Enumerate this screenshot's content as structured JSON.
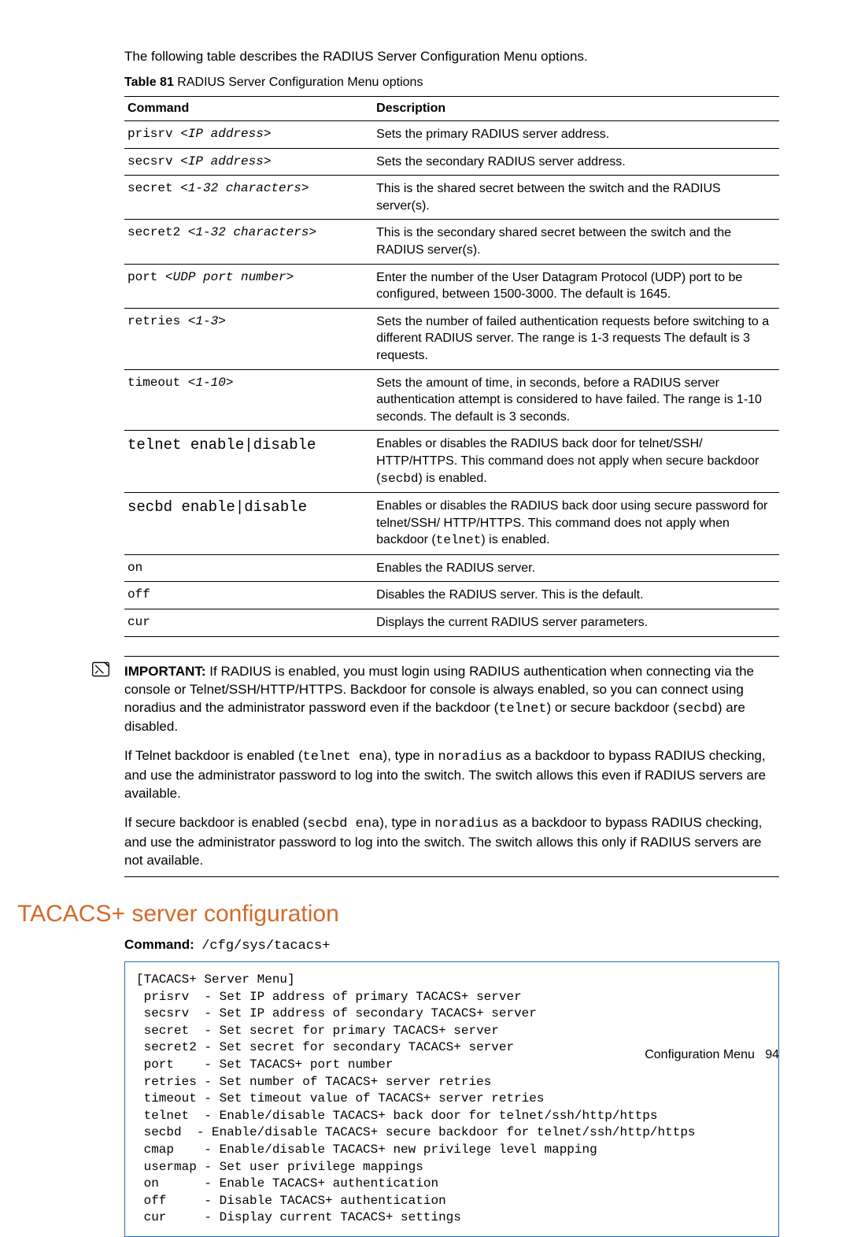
{
  "intro": "The following table describes the RADIUS Server Configuration Menu options.",
  "table_caption_label": "Table 81",
  "table_caption_title": "RADIUS Server Configuration Menu options",
  "table": {
    "headers": {
      "command": "Command",
      "description": "Description"
    },
    "rows": [
      {
        "cmd": "prisrv",
        "arg": "<IP address>",
        "big": false,
        "desc": "Sets the primary RADIUS server address."
      },
      {
        "cmd": "secsrv",
        "arg": "<IP address>",
        "big": false,
        "desc": "Sets the secondary RADIUS server address."
      },
      {
        "cmd": "secret",
        "arg": "<1-32 characters>",
        "big": false,
        "desc": "This is the shared secret between the switch and the RADIUS server(s)."
      },
      {
        "cmd": "secret2",
        "arg": "<1-32 characters>",
        "big": false,
        "desc": "This is the secondary shared secret between the switch and the RADIUS server(s)."
      },
      {
        "cmd": "port",
        "arg": "<UDP port number>",
        "big": false,
        "desc": "Enter the number of the User Datagram Protocol (UDP) port to be configured, between 1500-3000. The default is 1645."
      },
      {
        "cmd": "retries",
        "arg": "<1-3>",
        "big": false,
        "desc": "Sets the number of failed authentication requests before switching to a different RADIUS server. The range is 1-3 requests The default is 3 requests."
      },
      {
        "cmd": "timeout",
        "arg": "<1-10>",
        "big": false,
        "desc": "Sets the amount of time, in seconds, before a RADIUS server authentication attempt is considered to have failed. The range is 1-10 seconds. The default is 3 seconds."
      },
      {
        "cmd": "telnet enable|disable",
        "arg": "",
        "big": true,
        "desc_html": "Enables or disables the RADIUS back door for telnet/SSH/ HTTP/HTTPS. This command does not apply when secure backdoor (<code class=\"inline\">secbd</code>) is enabled."
      },
      {
        "cmd": "secbd enable|disable",
        "arg": "",
        "big": true,
        "desc_html": "Enables or disables the RADIUS back door using secure password for telnet/SSH/ HTTP/HTTPS. This command does not apply when backdoor (<code class=\"inline\">telnet</code>) is enabled."
      },
      {
        "cmd": "on",
        "arg": "",
        "big": false,
        "desc": "Enables the RADIUS server."
      },
      {
        "cmd": "off",
        "arg": "",
        "big": false,
        "desc": "Disables the RADIUS server. This is the default."
      },
      {
        "cmd": "cur",
        "arg": "",
        "big": false,
        "desc": "Displays the current RADIUS server parameters."
      }
    ]
  },
  "important_label": "IMPORTANT:",
  "important_p1_html": "If RADIUS is enabled, you must login using RADIUS authentication when connecting via the console or Telnet/SSH/HTTP/HTTPS. Backdoor for console is always enabled, so you can connect using noradius and the administrator password even if the backdoor (<code class=\"inline\">telnet</code>) or secure backdoor (<code class=\"inline\">secbd</code>) are disabled.",
  "important_p2_html": "If Telnet backdoor is enabled (<code class=\"inline\">telnet ena</code>), type in <code class=\"inline\">noradius</code> as a backdoor to bypass RADIUS checking, and use the administrator password to log into the switch. The switch allows this even if RADIUS servers are available.",
  "important_p3_html": "If secure backdoor is enabled (<code class=\"inline\">secbd ena</code>), type in <code class=\"inline\">noradius</code> as a backdoor to bypass RADIUS checking, and use the administrator password to log into the switch. The switch allows this only if RADIUS servers are not available.",
  "section_heading": "TACACS+ server configuration",
  "command_label": "Command:",
  "command_path": "/cfg/sys/tacacs+",
  "menu_text": "[TACACS+ Server Menu]\n prisrv  - Set IP address of primary TACACS+ server\n secsrv  - Set IP address of secondary TACACS+ server\n secret  - Set secret for primary TACACS+ server\n secret2 - Set secret for secondary TACACS+ server\n port    - Set TACACS+ port number\n retries - Set number of TACACS+ server retries\n timeout - Set timeout value of TACACS+ server retries\n telnet  - Enable/disable TACACS+ back door for telnet/ssh/http/https\n secbd  - Enable/disable TACACS+ secure backdoor for telnet/ssh/http/https\n cmap    - Enable/disable TACACS+ new privilege level mapping\n usermap - Set user privilege mappings\n on      - Enable TACACS+ authentication\n off     - Disable TACACS+ authentication\n cur     - Display current TACACS+ settings",
  "footer_text": "Configuration Menu",
  "footer_page": "94"
}
